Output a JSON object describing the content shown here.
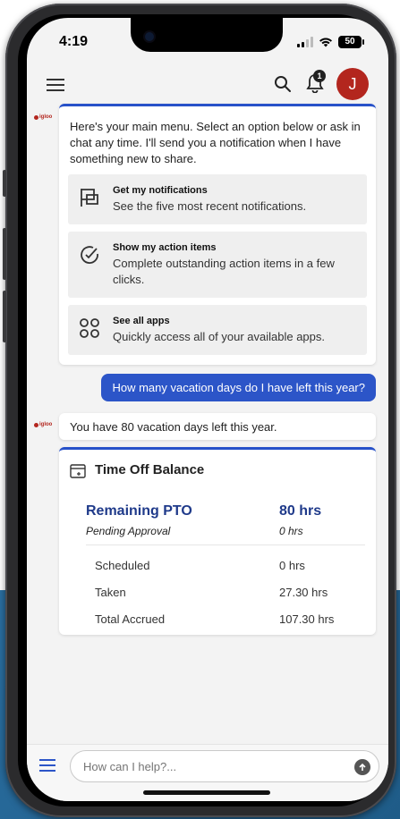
{
  "status_bar": {
    "time": "4:19",
    "battery": "50"
  },
  "header": {
    "avatar_initial": "J",
    "notification_count": "1"
  },
  "bot": {
    "logo_text": "igloo"
  },
  "intro": {
    "message": "Here's your main menu. Select an option below or ask in chat any time. I'll send you a notification when I have something new to share.",
    "options": [
      {
        "title": "Get my notifications",
        "description": "See the five most recent notifications.",
        "icon": "flag-icon"
      },
      {
        "title": "Show my action items",
        "description": "Complete outstanding action items in a few clicks.",
        "icon": "check-circle-icon"
      },
      {
        "title": "See all apps",
        "description": "Quickly access all of your available apps.",
        "icon": "apps-grid-icon"
      }
    ]
  },
  "user_message": "How many vacation days do I have left this year?",
  "bot_reply": "You have 80 vacation days left this year.",
  "time_off": {
    "title": "Time Off Balance",
    "remaining_label": "Remaining PTO",
    "remaining_value": "80 hrs",
    "pending_label": "Pending Approval",
    "pending_value": "0 hrs",
    "rows": [
      {
        "label": "Scheduled",
        "value": "0 hrs"
      },
      {
        "label": "Taken",
        "value": "27.30 hrs"
      },
      {
        "label": "Total Accrued",
        "value": "107.30 hrs"
      }
    ]
  },
  "composer": {
    "placeholder": "How can I help?..."
  },
  "colors": {
    "accent": "#2c55c8",
    "avatar": "#b3261e",
    "pto_heading": "#1f3a8a"
  }
}
